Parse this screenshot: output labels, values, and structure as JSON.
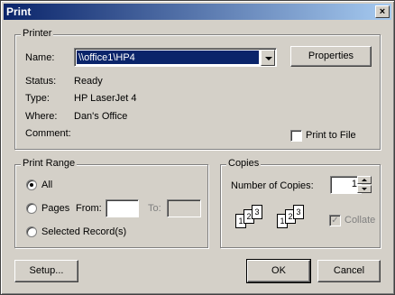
{
  "window": {
    "title": "Print",
    "close_glyph": "×"
  },
  "printer": {
    "group_label": "Printer",
    "name_label": "Name:",
    "name_value": "\\\\office1\\HP4",
    "properties_label": "Properties",
    "status_label": "Status:",
    "status_value": "Ready",
    "type_label": "Type:",
    "type_value": "HP LaserJet 4",
    "where_label": "Where:",
    "where_value": "Dan's Office",
    "comment_label": "Comment:",
    "comment_value": "",
    "print_to_file_label": "Print to File",
    "print_to_file_checked": false
  },
  "print_range": {
    "group_label": "Print Range",
    "all_label": "All",
    "pages_label": "Pages",
    "from_label": "From:",
    "from_value": "",
    "to_label": "To:",
    "to_value": "",
    "selected_records_label": "Selected Record(s)",
    "selected": "All"
  },
  "copies": {
    "group_label": "Copies",
    "number_label": "Number of Copies:",
    "number_value": "1",
    "collate_label": "Collate",
    "collate_checked": true,
    "collate_check_glyph": "✓",
    "page_numbers": [
      "1",
      "2",
      "3"
    ]
  },
  "buttons": {
    "setup": "Setup...",
    "ok": "OK",
    "cancel": "Cancel"
  },
  "colors": {
    "titlebar": "#0a246a",
    "face": "#d4d0c8",
    "selection": "#0a246a"
  }
}
